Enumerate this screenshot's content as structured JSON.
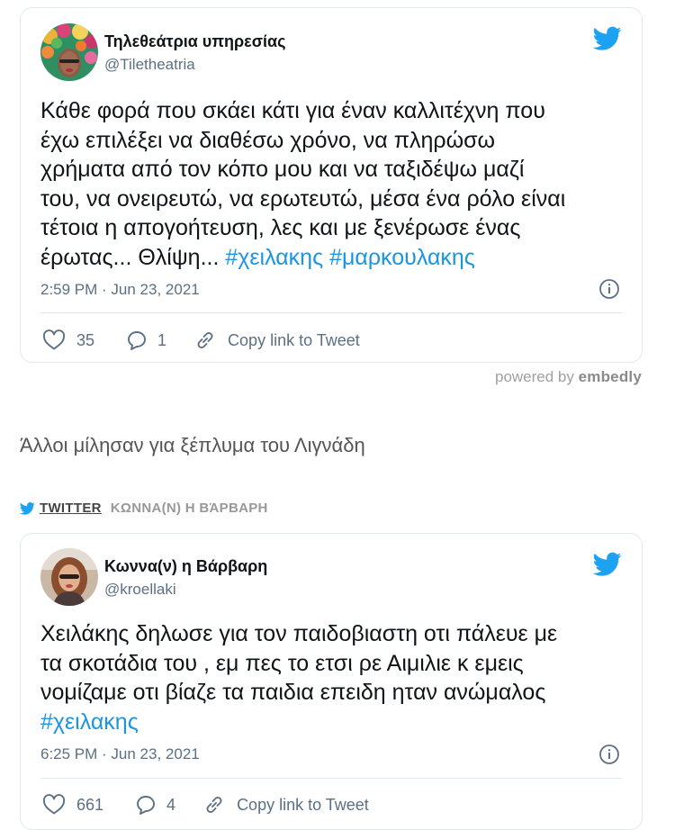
{
  "embed1": {
    "author_name": "Τηλεθεάτρια υπηρεσίας",
    "handle": "@Tiletheatria",
    "text_line1": "Κάθε φορά που σκάει κάτι για έναν καλλιτέχνη που",
    "text_line2": "έχω επιλέξει να διαθέσω χρόνο, να πληρώσω",
    "text_line3": "χρήματα από τον κόπο μου και να ταξιδέψω μαζί",
    "text_line4": "του, να ονειρευτώ, να ερωτευτώ, μέσα ένα ρόλο είναι",
    "text_line5": "τέτοια η απογοήτευση, λες και με ξενέρωσε ένας",
    "text_line6": "έρωτας... Θλίψη...",
    "hashtag1": "#χειλακης",
    "hashtag2": "#μαρκουλακης",
    "timestamp": "2:59 PM · Jun 23, 2021",
    "like_count": "35",
    "reply_count": "1",
    "copy_link_label": "Copy link to Tweet"
  },
  "powered_by": {
    "prefix": "powered by",
    "brand": "embedly"
  },
  "section_title": "Άλλοι μίλησαν για ξέπλυμα του Λιγνάδη",
  "source_bar": {
    "platform": "TWITTER",
    "author": "ΚΩΝΝΑ(Ν) Η ΒΆΡΒΑΡΗ"
  },
  "embed2": {
    "author_name": "Κωννα(ν) η Βάρβαρη",
    "handle": "@kroellaki",
    "text_line1": "Χειλάκης δηλωσε για τον παιδοβιαστη οτι πάλευε με",
    "text_line2": "τα σκοτάδια του , εμ πες το ετσι ρε Αιμιλιε κ εμεις",
    "text_line3": "νομίζαμε οτι βίαζε τα παιδια επειδη ηταν ανώμαλος",
    "hashtag1": "#χειλακης",
    "timestamp": "6:25 PM · Jun 23, 2021",
    "like_count": "661",
    "reply_count": "4",
    "copy_link_label": "Copy link to Tweet"
  },
  "colors": {
    "link": "#1b95e0",
    "twitter_blue": "#1da1f2",
    "muted": "#5b7083"
  },
  "icons": [
    "twitter-bird-icon",
    "info-icon",
    "heart-icon",
    "reply-icon",
    "link-icon"
  ]
}
